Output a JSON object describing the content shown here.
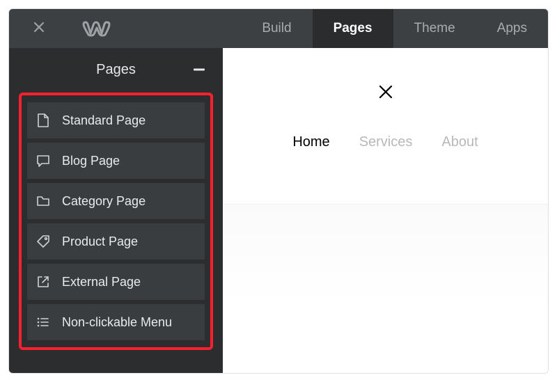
{
  "topbar": {
    "tabs": [
      "Build",
      "Pages",
      "Theme",
      "Apps"
    ],
    "activeTab": "Pages"
  },
  "sidebar": {
    "title": "Pages",
    "pageTypes": [
      {
        "label": "Standard Page",
        "icon": "page"
      },
      {
        "label": "Blog Page",
        "icon": "comment"
      },
      {
        "label": "Category Page",
        "icon": "folder"
      },
      {
        "label": "Product Page",
        "icon": "tag"
      },
      {
        "label": "External Page",
        "icon": "external"
      },
      {
        "label": "Non-clickable Menu",
        "icon": "menu"
      }
    ]
  },
  "preview": {
    "nav": {
      "items": [
        "Home",
        "Services",
        "About"
      ],
      "active": "Home"
    }
  }
}
